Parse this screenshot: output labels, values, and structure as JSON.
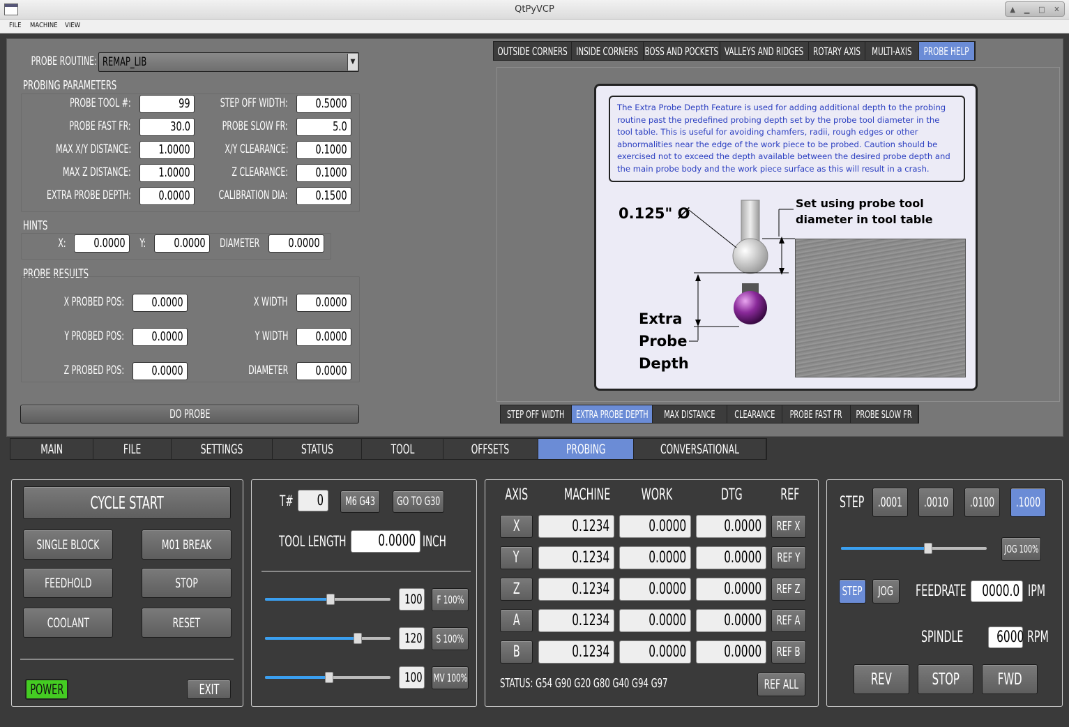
{
  "window": {
    "title": "QtPyVCP"
  },
  "menu": [
    "FILE",
    "MACHINE",
    "VIEW"
  ],
  "probe": {
    "routine_label": "PROBE ROUTINE:",
    "routine_value": "REMAP_LIB",
    "params_title": "PROBING PARAMETERS",
    "params_left": [
      {
        "label": "PROBE TOOL #:",
        "value": "99"
      },
      {
        "label": "PROBE FAST FR:",
        "value": "30.0"
      },
      {
        "label": "MAX X/Y DISTANCE:",
        "value": "1.0000"
      },
      {
        "label": "MAX Z DISTANCE:",
        "value": "1.0000"
      },
      {
        "label": "EXTRA PROBE DEPTH:",
        "value": "0.0000"
      }
    ],
    "params_right": [
      {
        "label": "STEP OFF WIDTH:",
        "value": "0.5000"
      },
      {
        "label": "PROBE SLOW FR:",
        "value": "5.0"
      },
      {
        "label": "X/Y CLEARANCE:",
        "value": "0.1000"
      },
      {
        "label": "Z CLEARANCE:",
        "value": "0.1000"
      },
      {
        "label": "CALIBRATION DIA:",
        "value": "0.1500"
      }
    ],
    "hints_title": "HINTS",
    "hints": {
      "x_label": "X:",
      "x": "0.0000",
      "y_label": "Y:",
      "y": "0.0000",
      "d_label": "DIAMETER",
      "d": "0.0000"
    },
    "results_title": "PROBE RESULTS",
    "results_left": [
      {
        "label": "X PROBED POS:",
        "value": "0.0000"
      },
      {
        "label": "Y PROBED POS:",
        "value": "0.0000"
      },
      {
        "label": "Z PROBED POS:",
        "value": "0.0000"
      }
    ],
    "results_right": [
      {
        "label": "X WIDTH",
        "value": "0.0000"
      },
      {
        "label": "Y WIDTH",
        "value": "0.0000"
      },
      {
        "label": "DIAMETER",
        "value": "0.0000"
      }
    ],
    "do_probe": "DO PROBE"
  },
  "probe_tabs": [
    "OUTSIDE CORNERS",
    "INSIDE CORNERS",
    "BOSS AND POCKETS",
    "VALLEYS AND RIDGES",
    "ROTARY AXIS",
    "MULTI-AXIS",
    "PROBE HELP"
  ],
  "help_tabs": [
    "STEP OFF WIDTH",
    "EXTRA PROBE DEPTH",
    "MAX DISTANCE",
    "CLEARANCE",
    "PROBE FAST FR",
    "PROBE SLOW FR"
  ],
  "help": {
    "text": "The Extra Probe Depth Feature is used for adding additional depth to the probing routine past the predefined probing depth set by the probe tool diameter in the tool table.  This is useful for avoiding chamfers, radii, rough edges or other abnormalities near the edge of the work piece to be probed.  Caution should be exercised not to exceed the depth available between the desired probe depth and the main probe body and the work piece surface as this will result in a crash.",
    "dia": "0.125\" Ø",
    "set1": "Set using probe tool",
    "set2": "diameter in tool table",
    "extra1": "Extra",
    "extra2": "Probe",
    "extra3": "Depth"
  },
  "main_tabs": [
    "MAIN",
    "FILE",
    "SETTINGS",
    "STATUS",
    "TOOL",
    "OFFSETS",
    "PROBING",
    "CONVERSATIONAL"
  ],
  "control": {
    "cycle_start": "CYCLE START",
    "single_block": "SINGLE BLOCK",
    "m01_break": "M01 BREAK",
    "feedhold": "FEEDHOLD",
    "stop": "STOP",
    "coolant": "COOLANT",
    "reset": "RESET",
    "power": "POWER",
    "exit": "EXIT"
  },
  "tool": {
    "t_label": "T#",
    "t_value": "0",
    "m6g43": "M6 G43",
    "g30": "GO TO G30",
    "length_label": "TOOL LENGTH",
    "length_value": "0.0000",
    "unit": "INCH",
    "overrides": [
      {
        "value": "100",
        "button": "F 100%",
        "level": 0.52
      },
      {
        "value": "120",
        "button": "S 100%",
        "level": 0.74
      },
      {
        "value": "100",
        "button": "MV 100%",
        "level": 0.51
      }
    ]
  },
  "dro": {
    "headers": [
      "AXIS",
      "MACHINE",
      "WORK",
      "DTG",
      "REF"
    ],
    "rows": [
      {
        "axis": "X",
        "machine": "0.1234",
        "work": "0.0000",
        "dtg": "0.0000",
        "ref": "REF X"
      },
      {
        "axis": "Y",
        "machine": "0.1234",
        "work": "0.0000",
        "dtg": "0.0000",
        "ref": "REF Y"
      },
      {
        "axis": "Z",
        "machine": "0.1234",
        "work": "0.0000",
        "dtg": "0.0000",
        "ref": "REF Z"
      },
      {
        "axis": "A",
        "machine": "0.1234",
        "work": "0.0000",
        "dtg": "0.0000",
        "ref": "REF A"
      },
      {
        "axis": "B",
        "machine": "0.1234",
        "work": "0.0000",
        "dtg": "0.0000",
        "ref": "REF B"
      }
    ],
    "status": "STATUS:  G54  G90  G20  G80  G40  G94  G97",
    "ref_all": "REF ALL"
  },
  "jog": {
    "step_label": "STEP",
    "steps": [
      ".0001",
      ".0010",
      ".0100",
      ".1000"
    ],
    "jog_pct": "JOG 100%",
    "jog_level": 0.6,
    "step_btn": "STEP",
    "jog_btn": "JOG",
    "feed_label": "FEEDRATE",
    "feed_value": "0000.0",
    "feed_unit": "IPM",
    "spindle_label": "SPINDLE",
    "spindle_value": "6000",
    "spindle_unit": "RPM",
    "rev": "REV",
    "stop": "STOP",
    "fwd": "FWD"
  },
  "colors": {
    "accent": "#6b8cd6",
    "power": "#44cc22",
    "probe_ball": "#8a2a9a"
  }
}
